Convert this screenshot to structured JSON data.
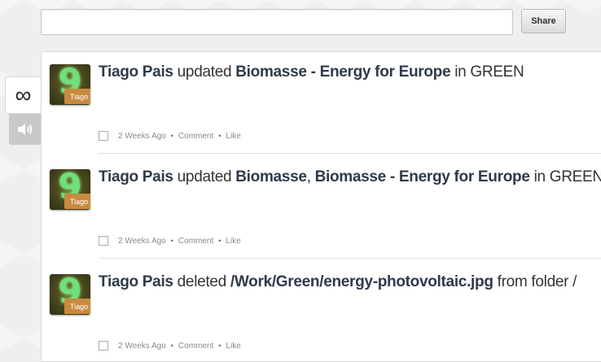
{
  "share": {
    "input_value": "",
    "button_label": "Share"
  },
  "tabs": {
    "all_icon": "infinity-icon",
    "all_glyph": "∞",
    "audio_icon": "speaker-icon"
  },
  "feed": {
    "items": [
      {
        "avatar_glyph": "9",
        "avatar_label": "Tiago",
        "actor": "Tiago Pais",
        "verb": " updated ",
        "target1": "Biomasse - Energy for Europe",
        "sep": "",
        "target2": "",
        "suffix": " in GREEN",
        "time": "2 Weeks Ago",
        "comment_label": "Comment",
        "like_label": "Like"
      },
      {
        "avatar_glyph": "9",
        "avatar_label": "Tiago",
        "actor": "Tiago Pais",
        "verb": " updated ",
        "target1": "Biomasse",
        "sep": ", ",
        "target2": "Biomasse - Energy for Europe",
        "suffix": " in GREEN",
        "time": "2 Weeks Ago",
        "comment_label": "Comment",
        "like_label": "Like"
      },
      {
        "avatar_glyph": "9",
        "avatar_label": "Tiago",
        "actor": "Tiago Pais",
        "verb": " deleted ",
        "target1": "/Work/Green/energy-photovoltaic.jpg",
        "sep": "",
        "target2": "",
        "suffix": " from folder /",
        "time": "2 Weeks Ago",
        "comment_label": "Comment",
        "like_label": "Like"
      }
    ]
  }
}
